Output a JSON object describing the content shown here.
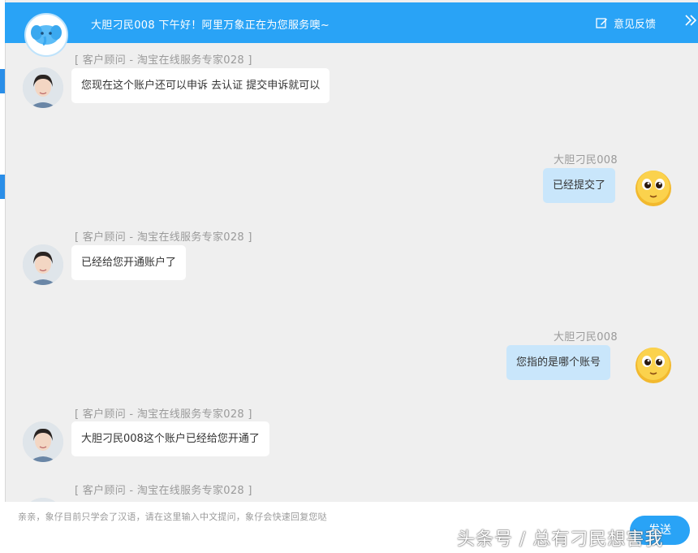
{
  "header": {
    "greeting": "大胆刁民008 下午好！阿里万象正在为您服务噢~",
    "feedback_label": "意见反馈",
    "brand_color": "#29a3f6"
  },
  "messages": [
    {
      "from": "agent",
      "sender": "[ 客户顾问 - 淘宝在线服务专家028 ]",
      "text": "您现在这个账户还可以申诉  去认证 提交申诉就可以"
    },
    {
      "from": "me",
      "sender": "大胆刁民008",
      "text": "已经提交了"
    },
    {
      "from": "agent",
      "sender": "[ 客户顾问 - 淘宝在线服务专家028 ]",
      "text": "已经给您开通账户了"
    },
    {
      "from": "me",
      "sender": "大胆刁民008",
      "text": "您指的是哪个账号"
    },
    {
      "from": "agent",
      "sender": "[ 客户顾问 - 淘宝在线服务专家028 ]",
      "text": "大胆刁民008这个账户已经给您开通了"
    },
    {
      "from": "agent",
      "sender": "[ 客户顾问 - 淘宝在线服务专家028 ]",
      "text": ""
    }
  ],
  "input": {
    "placeholder": "亲亲，象仔目前只学会了汉语，请在这里输入中文提问，象仔会快速回复您哒",
    "send_label": "发送"
  },
  "watermark": "头条号 / 总有刁民想害我"
}
